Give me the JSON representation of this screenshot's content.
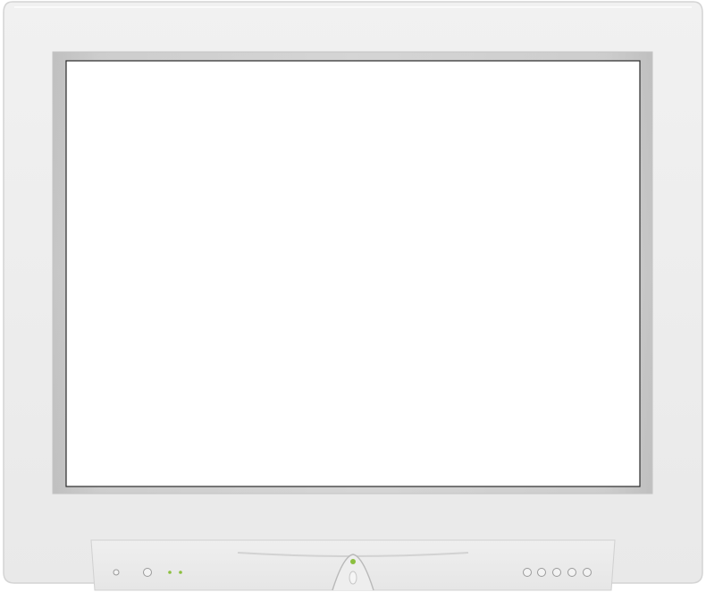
{
  "monitor": {
    "device": "crt-monitor",
    "screen": {
      "state": "blank",
      "color": "#ffffff"
    },
    "bezel_color": "#ededed",
    "screen_frame_color": "#c9c9c9",
    "control_panel": {
      "power_led": {
        "state": "on",
        "color": "#8cbf3f"
      },
      "status_leds": [
        {
          "color": "#8cbf3f"
        },
        {
          "color": "#8cbf3f"
        }
      ],
      "left_buttons_count": 2,
      "right_buttons_count": 5
    },
    "icons": {
      "power": "power-button-icon",
      "buttons": "round-control-button-icon"
    }
  }
}
